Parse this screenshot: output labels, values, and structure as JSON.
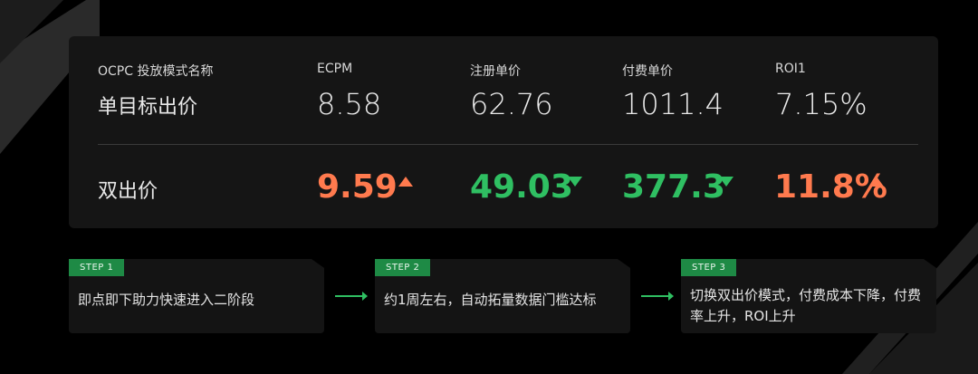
{
  "table": {
    "headers": [
      "OCPC 投放模式名称",
      "ECPM",
      "注册单价",
      "付费单价",
      "ROI1"
    ],
    "row1": {
      "label": "单目标出价",
      "values": [
        "8.58",
        "62.76",
        "1011.4",
        "7.15%"
      ]
    },
    "row2": {
      "label": "双出价",
      "values": [
        "9.59",
        "49.03",
        "377.3",
        "11.8%"
      ],
      "trends": [
        "up",
        "down",
        "down",
        "up"
      ]
    }
  },
  "steps": [
    {
      "badge": "STEP 1",
      "text": "即点即下助力快速进入二阶段"
    },
    {
      "badge": "STEP 2",
      "text": "约1周左右，自动拓量数据门槛达标"
    },
    {
      "badge": "STEP 3",
      "text": "切换双出价模式，付费成本下降，付费率上升，ROI上升"
    }
  ],
  "colors": {
    "up": "#ff7a4e",
    "down": "#2fbf62",
    "badge": "#1e8a45"
  }
}
